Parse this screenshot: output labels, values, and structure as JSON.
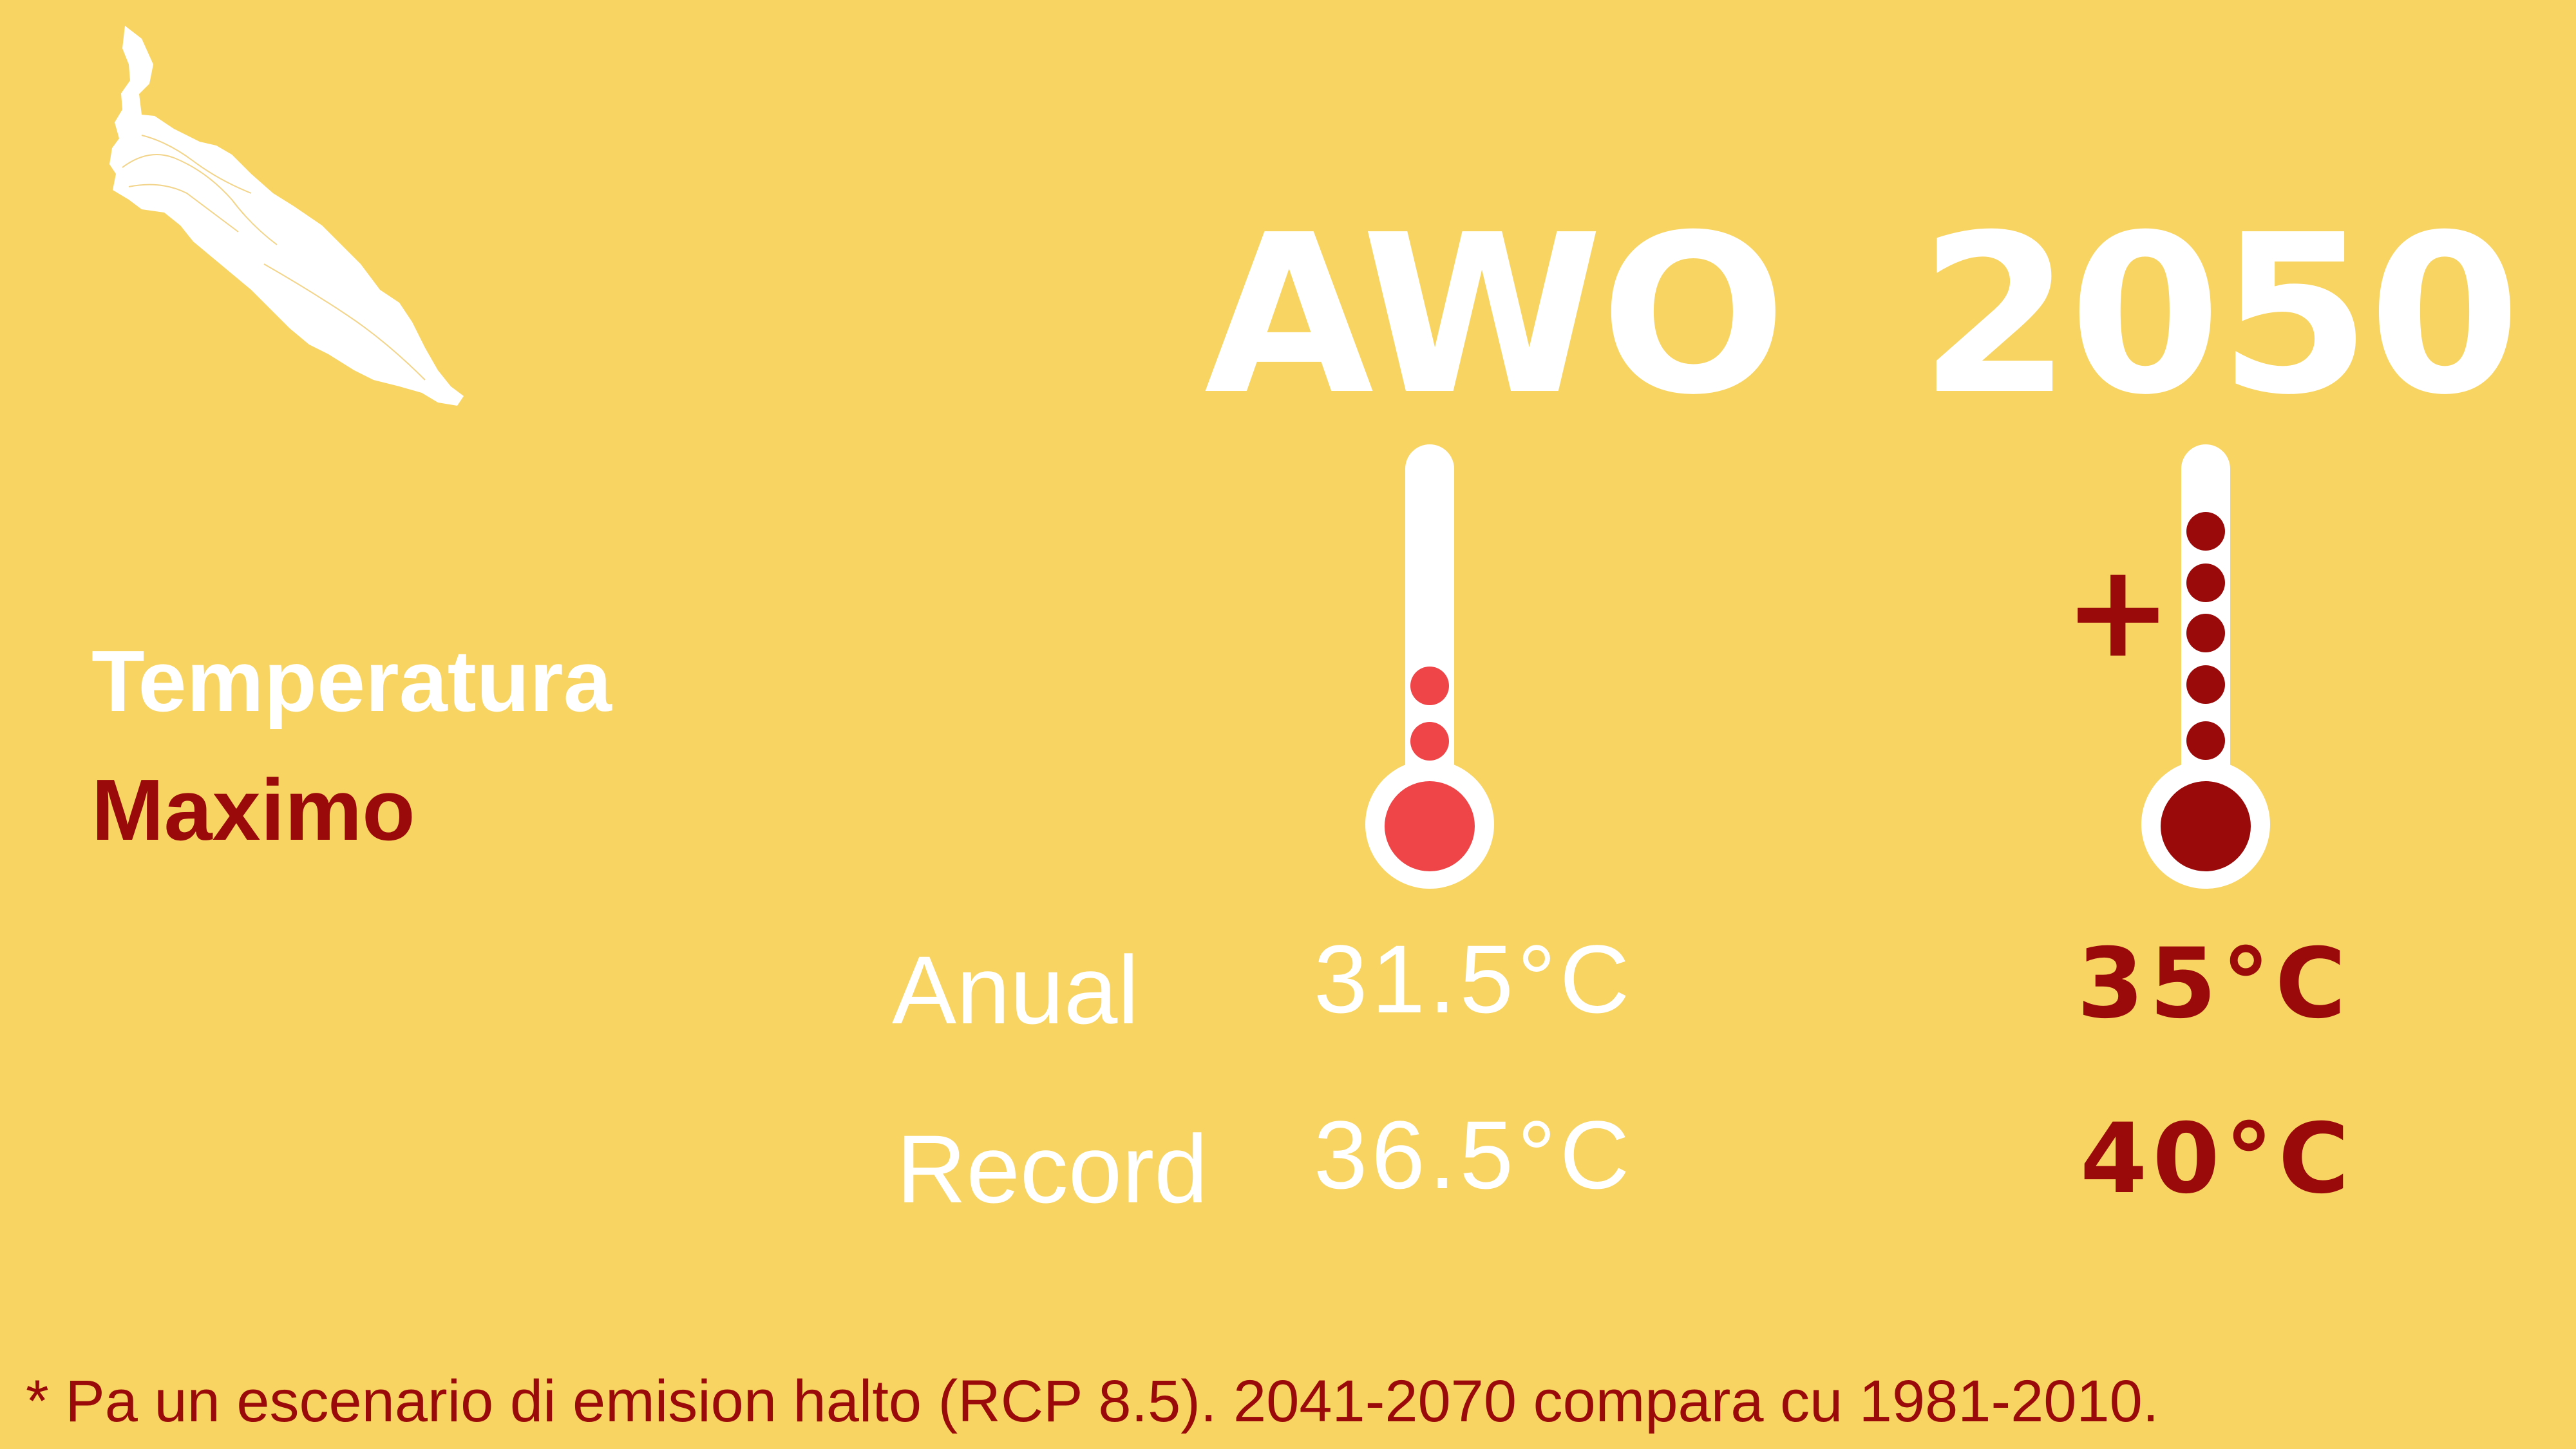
{
  "colors": {
    "background": "#F8D462",
    "accent_red": "#9B0A0A",
    "light_red": "#EF4548",
    "white": "#FFFFFF"
  },
  "map": {
    "icon": "aruba-island-map-icon"
  },
  "title": {
    "line1": "Temperatura",
    "line2": "Maximo"
  },
  "columns": {
    "now": "AWO",
    "future": "2050"
  },
  "thermometers": {
    "now": {
      "icon": "thermometer-icon",
      "dots": 2
    },
    "future": {
      "icon": "thermometer-icon",
      "dots": 5,
      "plus": "+"
    }
  },
  "rows": [
    {
      "label": "Anual",
      "now": "31.5°C",
      "future": "35°C"
    },
    {
      "label": "Record",
      "now": "36.5°C",
      "future": "40°C"
    }
  ],
  "footnote": "* Pa un escenario di emision halto (RCP 8.5). 2041-2070 compara cu 1981-2010."
}
